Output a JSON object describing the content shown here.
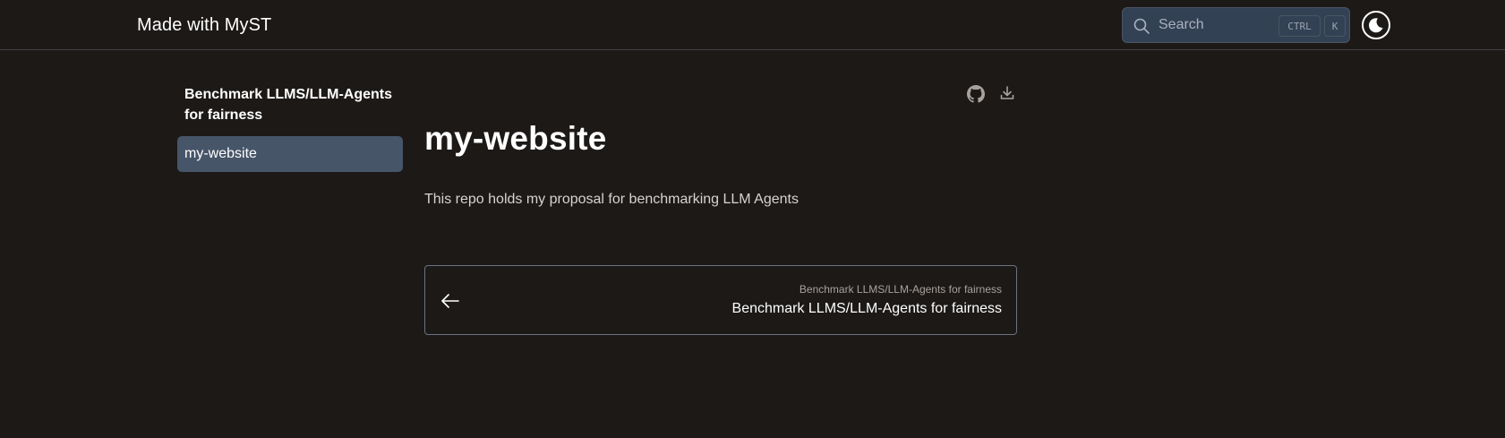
{
  "header": {
    "site_title": "Made with MyST",
    "search": {
      "placeholder": "Search",
      "shortcut_ctrl": "CTRL",
      "shortcut_key": "K"
    },
    "theme_toggle_icon": "moon-icon"
  },
  "sidebar": {
    "heading": "Benchmark LLMS/LLM-Agents for fairness",
    "items": [
      {
        "label": "my-website",
        "active": true
      }
    ]
  },
  "toolbar": {
    "icons": [
      "github-icon",
      "download-icon"
    ]
  },
  "main": {
    "title": "my-website",
    "description": "This repo holds my proposal for benchmarking LLM Agents"
  },
  "navigation": {
    "previous": {
      "icon": "arrow-left-icon",
      "caption": "Benchmark LLMS/LLM-Agents for fairness",
      "title": "Benchmark LLMS/LLM-Agents for fairness"
    }
  },
  "colors": {
    "background": "#1c1917",
    "active_item": "#475569",
    "search_bg": "#334155"
  }
}
